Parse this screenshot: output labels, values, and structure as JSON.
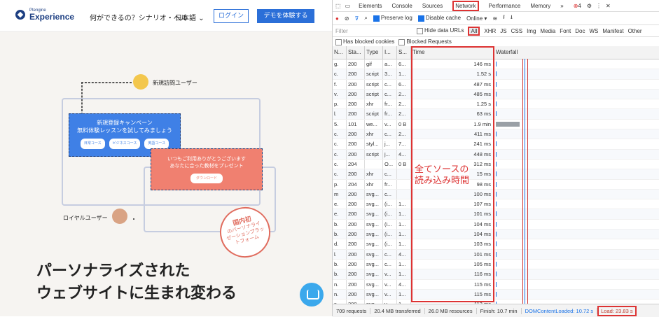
{
  "site": {
    "logo_top": "Ptengine",
    "logo_main": "Experience",
    "nav_text": "何ができるの？シナリオ・ヘル",
    "lang": "日本語",
    "login": "ログイン",
    "demo": "デモを体験する",
    "new_user_label": "新規訪問ユーザー",
    "royal_user_label": "ロイヤルユーザー",
    "blue_card_line1": "新規登録キャンペーン",
    "blue_card_line2": "無料体験レッスンを試してみましょう",
    "chips": [
      "日常コース",
      "ビジネスコース",
      "英語コース"
    ],
    "orange_card_line1": "いつもご利用ありがとうございます",
    "orange_card_line2": "あなたに合った教材をプレゼント",
    "orange_btn": "ダウンロード",
    "stamp_line1": "国内初",
    "stamp_line2": "のパーソナライ",
    "stamp_line3": "ゼーションプラッ",
    "stamp_line4": "トフォーム",
    "headline_line1": "パーソナライズされた",
    "headline_line2": "ウェブサイトに生まれ変わる"
  },
  "devtools": {
    "tabs": [
      "Elements",
      "Console",
      "Sources",
      "Network",
      "Performance",
      "Memory",
      "»"
    ],
    "error_count": "4",
    "toolbar": {
      "preserve_log": "Preserve log",
      "disable_cache": "Disable cache",
      "throttle": "Online"
    },
    "filter": {
      "placeholder": "Filter",
      "hide_data_urls": "Hide data URLs",
      "types": [
        "All",
        "XHR",
        "JS",
        "CSS",
        "Img",
        "Media",
        "Font",
        "Doc",
        "WS",
        "Manifest",
        "Other"
      ]
    },
    "blocked": {
      "has_blocked_cookies": "Has blocked cookies",
      "blocked_requests": "Blocked Requests"
    },
    "columns": [
      "N...",
      "Sta...",
      "Type",
      "I...",
      "S...",
      "Time",
      "Waterfall"
    ],
    "rows": [
      {
        "name": "g.",
        "status": "200",
        "type": "gif",
        "init": "a...",
        "size": "6...",
        "time": "146 ms"
      },
      {
        "name": "c.",
        "status": "200",
        "type": "script",
        "init": "3...",
        "size": "1...",
        "time": "1.52 s"
      },
      {
        "name": "f.",
        "status": "200",
        "type": "script",
        "init": "c...",
        "size": "6...",
        "time": "487 ms"
      },
      {
        "name": "v.",
        "status": "200",
        "type": "script",
        "init": "c...",
        "size": "2...",
        "time": "485 ms"
      },
      {
        "name": "p.",
        "status": "200",
        "type": "xhr",
        "init": "fr...",
        "size": "2...",
        "time": "1.25 s"
      },
      {
        "name": "l.",
        "status": "200",
        "type": "script",
        "init": "fr...",
        "size": "2...",
        "time": "63 ms"
      },
      {
        "name": "5.",
        "status": "101",
        "type": "we...",
        "init": "v...",
        "size": "0 B",
        "time": "1.9 min"
      },
      {
        "name": "c.",
        "status": "200",
        "type": "xhr",
        "init": "c...",
        "size": "2...",
        "time": "411 ms"
      },
      {
        "name": "c.",
        "status": "200",
        "type": "styl...",
        "init": "j...",
        "size": "7...",
        "time": "241 ms"
      },
      {
        "name": "c.",
        "status": "200",
        "type": "script",
        "init": "j...",
        "size": "4...",
        "time": "448 ms"
      },
      {
        "name": "c.",
        "status": "204",
        "type": "",
        "init": "O...",
        "size": "0 B",
        "time": "312 ms"
      },
      {
        "name": "c.",
        "status": "200",
        "type": "xhr",
        "init": "c...",
        "size": "",
        "time": "15 ms"
      },
      {
        "name": "p.",
        "status": "204",
        "type": "xhr",
        "init": "fr...",
        "size": "",
        "time": "98 ms"
      },
      {
        "name": "m",
        "status": "200",
        "type": "svg...",
        "init": "c...",
        "size": "",
        "time": "100 ms"
      },
      {
        "name": "e.",
        "status": "200",
        "type": "svg...",
        "init": "(i...",
        "size": "1...",
        "time": "107 ms"
      },
      {
        "name": "e.",
        "status": "200",
        "type": "svg...",
        "init": "(i...",
        "size": "1...",
        "time": "101 ms"
      },
      {
        "name": "b.",
        "status": "200",
        "type": "svg...",
        "init": "(i...",
        "size": "1...",
        "time": "104 ms"
      },
      {
        "name": "b.",
        "status": "200",
        "type": "svg...",
        "init": "(i...",
        "size": "1...",
        "time": "104 ms"
      },
      {
        "name": "d.",
        "status": "200",
        "type": "svg...",
        "init": "(i...",
        "size": "1...",
        "time": "103 ms"
      },
      {
        "name": "l.",
        "status": "200",
        "type": "svg...",
        "init": "c...",
        "size": "4...",
        "time": "101 ms"
      },
      {
        "name": "b.",
        "status": "200",
        "type": "svg...",
        "init": "c...",
        "size": "1...",
        "time": "105 ms"
      },
      {
        "name": "b.",
        "status": "200",
        "type": "svg...",
        "init": "v...",
        "size": "1...",
        "time": "116 ms"
      },
      {
        "name": "n.",
        "status": "200",
        "type": "svg...",
        "init": "v...",
        "size": "4...",
        "time": "115 ms"
      },
      {
        "name": "n.",
        "status": "200",
        "type": "svg...",
        "init": "v...",
        "size": "1...",
        "time": "115 ms"
      },
      {
        "name": "s.",
        "status": "200",
        "type": "svg...",
        "init": "v...",
        "size": "1...",
        "time": "113 ms"
      }
    ],
    "annotation_line1": "全てソースの",
    "annotation_line2": "読み込み時間",
    "status": {
      "requests": "709 requests",
      "transferred": "20.4 MB transferred",
      "resources": "26.0 MB resources",
      "finish": "Finish: 10.7 min",
      "dom": "DOMContentLoaded: 10.72 s",
      "load": "Load: 23.83 s"
    }
  }
}
